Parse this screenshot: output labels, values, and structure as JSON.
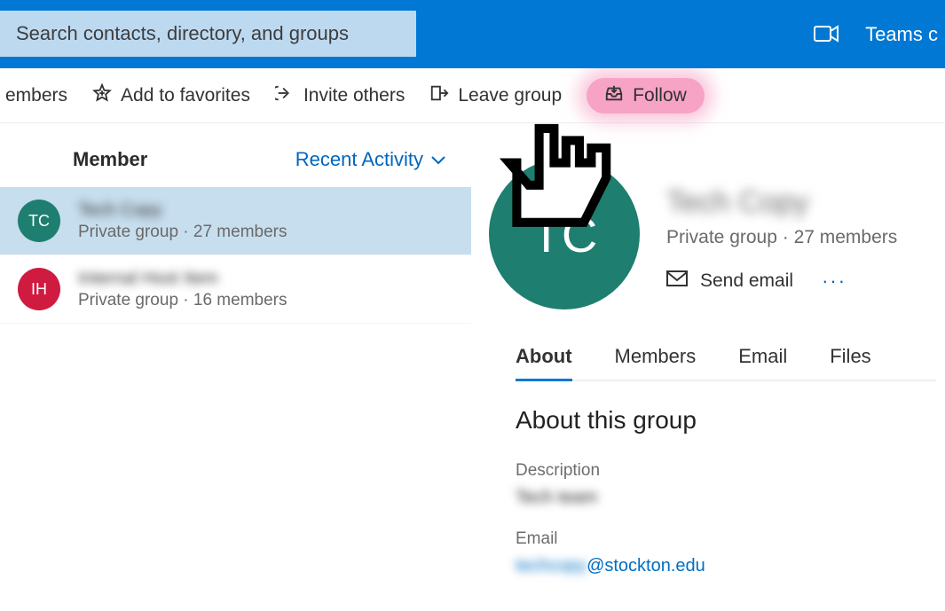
{
  "banner": {
    "search_placeholder": "Search contacts, directory, and groups",
    "teams_label": "Teams c"
  },
  "toolbar": {
    "members_partial": "embers",
    "add_favorites": "Add to favorites",
    "invite_others": "Invite others",
    "leave_group": "Leave group",
    "follow": "Follow"
  },
  "left": {
    "header_title": "Member",
    "sort_label": "Recent Activity",
    "items": [
      {
        "initials": "TC",
        "avatar_color": "teal",
        "name_blurred": "Tech Copy",
        "meta": "Private group · 27 members",
        "selected": true
      },
      {
        "initials": "IH",
        "avatar_color": "red",
        "name_blurred": "Internal Host Item",
        "meta": "Private group · 16 members",
        "selected": false
      }
    ]
  },
  "detail": {
    "avatar_initials": "TC",
    "group_name_blurred": "Tech Copy",
    "group_meta": "Private group · 27 members",
    "send_email_label": "Send email",
    "tabs": [
      "About",
      "Members",
      "Email",
      "Files"
    ],
    "active_tab": "About",
    "about_heading": "About this group",
    "description_label": "Description",
    "description_value_blurred": "Tech team",
    "email_label": "Email",
    "email_prefix_blurred": "techcopy",
    "email_suffix": "@stockton.edu"
  }
}
